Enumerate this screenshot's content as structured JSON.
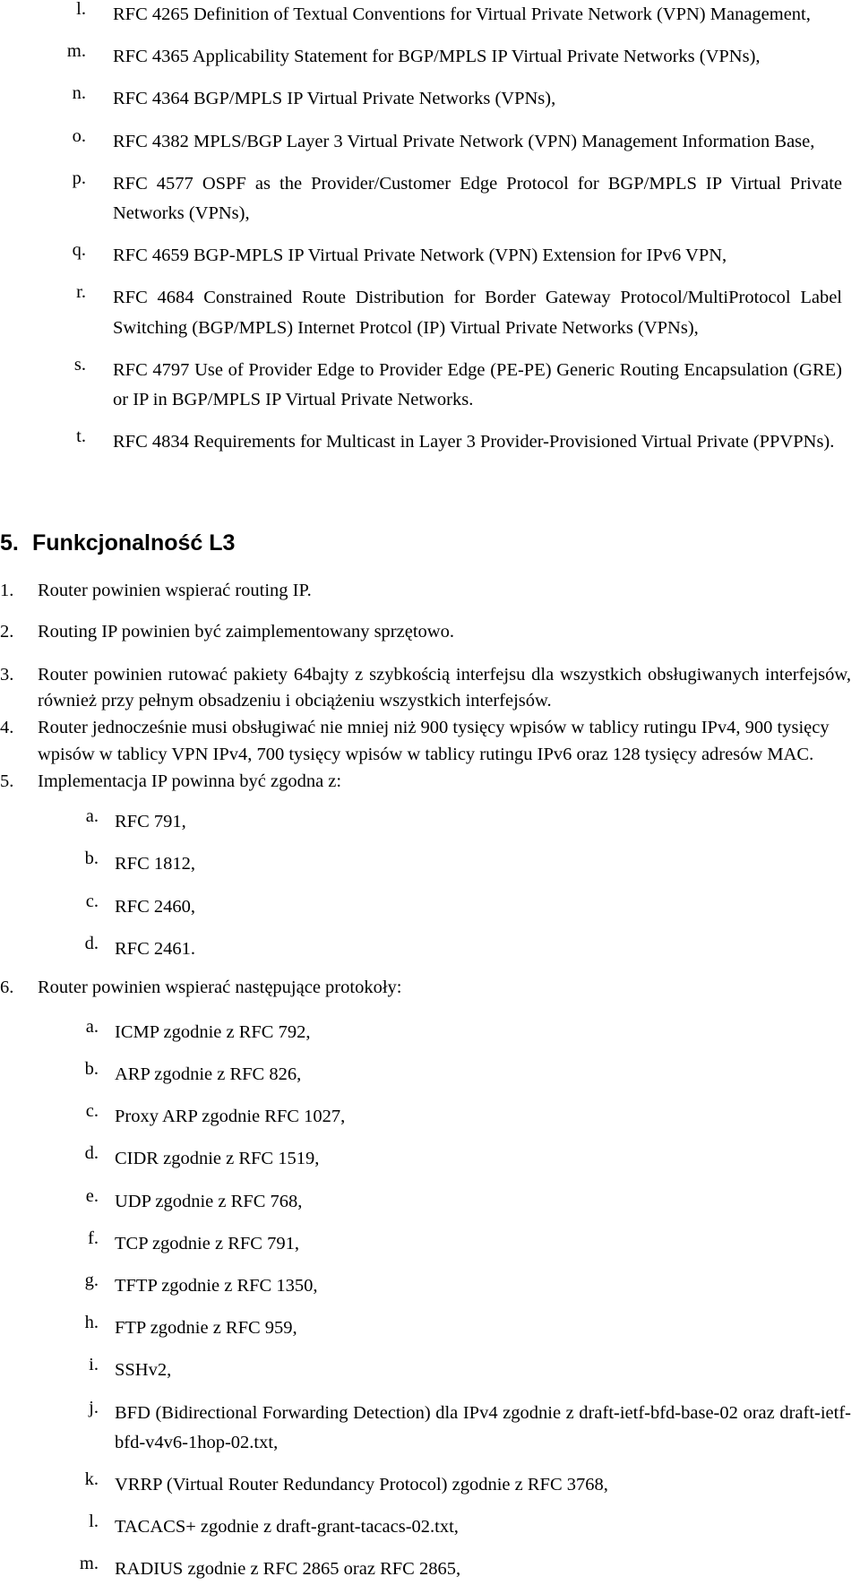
{
  "document": {
    "language": "pl",
    "rfc_list_continued": {
      "items": [
        {
          "marker": "l.",
          "text": "RFC 4265 Definition of Textual Conventions for Virtual Private Network (VPN) Management,"
        },
        {
          "marker": "m.",
          "text": "RFC 4365 Applicability Statement for BGP/MPLS IP Virtual Private Networks (VPNs),"
        },
        {
          "marker": "n.",
          "text": "RFC 4364 BGP/MPLS IP Virtual Private Networks (VPNs),"
        },
        {
          "marker": "o.",
          "text": "RFC 4382 MPLS/BGP Layer 3 Virtual Private Network (VPN) Management Information Base,"
        },
        {
          "marker": "p.",
          "text": "RFC 4577 OSPF as the Provider/Customer Edge Protocol for BGP/MPLS IP Virtual Private Networks (VPNs),"
        },
        {
          "marker": "q.",
          "text": "RFC 4659 BGP-MPLS IP Virtual Private Network (VPN) Extension for IPv6 VPN,"
        },
        {
          "marker": "r.",
          "text": "RFC 4684 Constrained Route Distribution for Border Gateway Protocol/MultiProtocol Label Switching (BGP/MPLS) Internet Protcol (IP) Virtual Private Networks (VPNs),"
        },
        {
          "marker": "s.",
          "text": "RFC 4797 Use of Provider Edge to Provider Edge (PE-PE) Generic Routing Encapsulation (GRE) or IP in BGP/MPLS IP Virtual Private Networks."
        },
        {
          "marker": "t.",
          "text": "RFC 4834 Requirements for Multicast in Layer 3 Provider-Provisioned Virtual Private (PPVPNs)."
        }
      ]
    },
    "section": {
      "number": "5.",
      "title": "Funkcjonalność L3",
      "items": [
        {
          "marker": "1.",
          "text": "Router powinien wspierać routing IP."
        },
        {
          "marker": "2.",
          "text": "Routing IP powinien być zaimplementowany sprzętowo."
        },
        {
          "marker": "3.",
          "text": "Router powinien rutować pakiety 64bajty z szybkością interfejsu dla wszystkich obsługiwanych interfejsów, również przy pełnym obsadzeniu i obciążeniu wszystkich interfejsów."
        },
        {
          "marker": "4.",
          "text": "Router jednocześnie musi obsługiwać nie mniej niż 900 tysięcy wpisów w tablicy rutingu IPv4, 900 tysięcy wpisów w tablicy VPN IPv4, 700 tysięcy wpisów w tablicy rutingu IPv6 oraz 128 tysięcy adresów MAC."
        },
        {
          "marker": "5.",
          "text": "Implementacja IP powinna być zgodna z:"
        }
      ],
      "item5_sub": [
        {
          "marker": "a.",
          "text": "RFC 791,"
        },
        {
          "marker": "b.",
          "text": "RFC 1812,"
        },
        {
          "marker": "c.",
          "text": "RFC 2460,"
        },
        {
          "marker": "d.",
          "text": "RFC 2461."
        }
      ],
      "item6": {
        "marker": "6.",
        "text": "Router powinien wspierać następujące protokoły:"
      },
      "item6_sub": [
        {
          "marker": "a.",
          "text": "ICMP zgodnie z RFC 792,"
        },
        {
          "marker": "b.",
          "text": "ARP zgodnie z RFC 826,"
        },
        {
          "marker": "c.",
          "text": "Proxy ARP zgodnie RFC 1027,"
        },
        {
          "marker": "d.",
          "text": "CIDR zgodnie z RFC 1519,"
        },
        {
          "marker": "e.",
          "text": "UDP zgodnie z RFC 768,"
        },
        {
          "marker": "f.",
          "text": "TCP zgodnie z RFC 791,"
        },
        {
          "marker": "g.",
          "text": "TFTP zgodnie z RFC 1350,"
        },
        {
          "marker": "h.",
          "text": "FTP zgodnie z RFC 959,"
        },
        {
          "marker": "i.",
          "text": "SSHv2,"
        },
        {
          "marker": "j.",
          "text": "BFD (Bidirectional Forwarding Detection) dla IPv4 zgodnie z draft-ietf-bfd-base-02 oraz draft-ietf-bfd-v4v6-1hop-02.txt,"
        },
        {
          "marker": "k.",
          "text": "VRRP (Virtual Router Redundancy Protocol) zgodnie z RFC 3768,"
        },
        {
          "marker": "l.",
          "text": "TACACS+ zgodnie z draft-grant-tacacs-02.txt,"
        },
        {
          "marker": "m.",
          "text": "RADIUS zgodnie z RFC 2865 oraz RFC 2865,"
        }
      ]
    }
  }
}
